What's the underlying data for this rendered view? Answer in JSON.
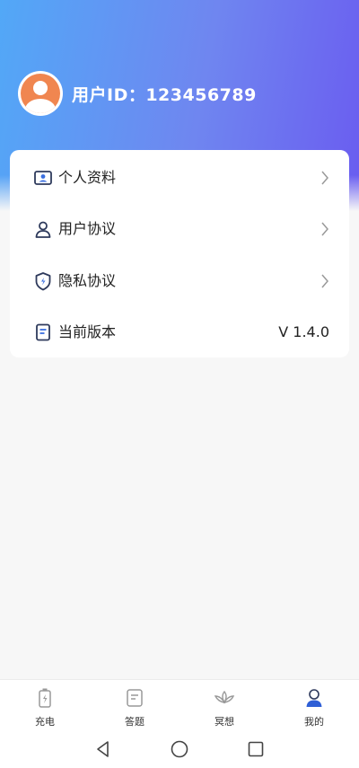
{
  "profile": {
    "user_id_label": "用户ID：123456789",
    "avatar_icon": "user-avatar-icon"
  },
  "menu": {
    "items": [
      {
        "label": "个人资料",
        "icon": "id-card-icon"
      },
      {
        "label": "用户协议",
        "icon": "person-icon"
      },
      {
        "label": "隐私协议",
        "icon": "shield-icon"
      },
      {
        "label": "当前版本",
        "icon": "document-icon",
        "value": "V 1.4.0"
      }
    ]
  },
  "tabbar": {
    "tabs": [
      {
        "label": "充电",
        "icon": "battery-charge-icon",
        "active": false
      },
      {
        "label": "答题",
        "icon": "note-icon",
        "active": false
      },
      {
        "label": "冥想",
        "icon": "lotus-icon",
        "active": false
      },
      {
        "label": "我的",
        "icon": "profile-icon",
        "active": true
      }
    ]
  },
  "colors": {
    "header_gradient_start": "#52a8f7",
    "header_gradient_end": "#6a5cf0",
    "avatar_orange": "#f08650",
    "active_tab_blue": "#2f5fd6",
    "icon_navy": "#2e3a5c"
  }
}
